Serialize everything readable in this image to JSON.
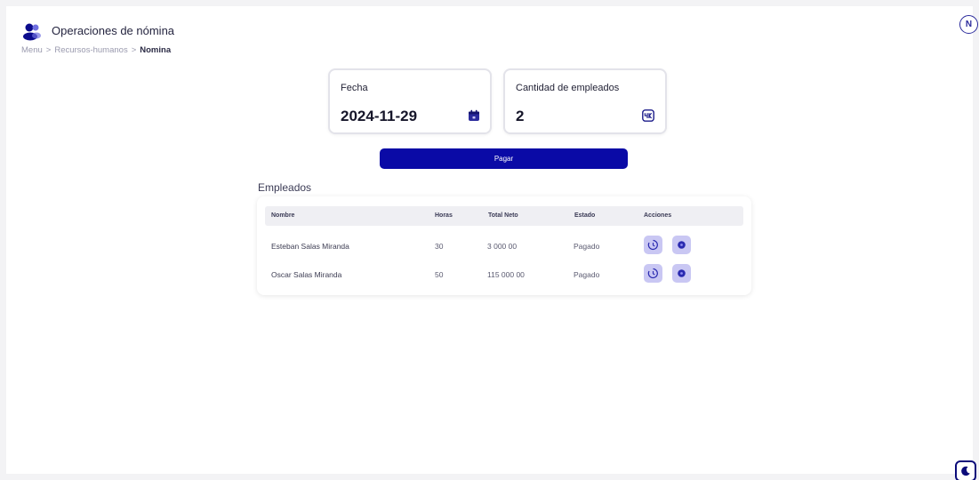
{
  "header": {
    "title": "Operaciones de nómina",
    "logo_icon": "user-group-icon",
    "avatar_initial": "N"
  },
  "breadcrumb": {
    "items": [
      "Menu",
      "Recursos-humanos"
    ],
    "separator": ">",
    "current": "Nomina"
  },
  "cards": {
    "fecha": {
      "label": "Fecha",
      "value": "2024-11-29",
      "icon": "calendar-icon"
    },
    "empleados": {
      "label": "Cantidad de empleados",
      "value": "2",
      "icon": "keyboard-icon"
    }
  },
  "actions": {
    "pay_label": "Pagar"
  },
  "employees": {
    "title": "Empleados",
    "columns": [
      "Nombre",
      "Horas",
      "Total Neto",
      "Estado",
      "Acciones"
    ],
    "rows": [
      {
        "name": "Esteban Salas Miranda",
        "hours": "30",
        "total": "3 000 00",
        "status": "Pagado"
      },
      {
        "name": "Oscar Salas Miranda",
        "hours": "50",
        "total": "115 000 00",
        "status": "Pagado"
      }
    ],
    "row_actions": [
      "history-icon",
      "view-icon"
    ]
  },
  "theme": {
    "accent": "#0a0aa6",
    "action_bg": "#c9c7f3",
    "toggle_icon": "moon-icon"
  }
}
